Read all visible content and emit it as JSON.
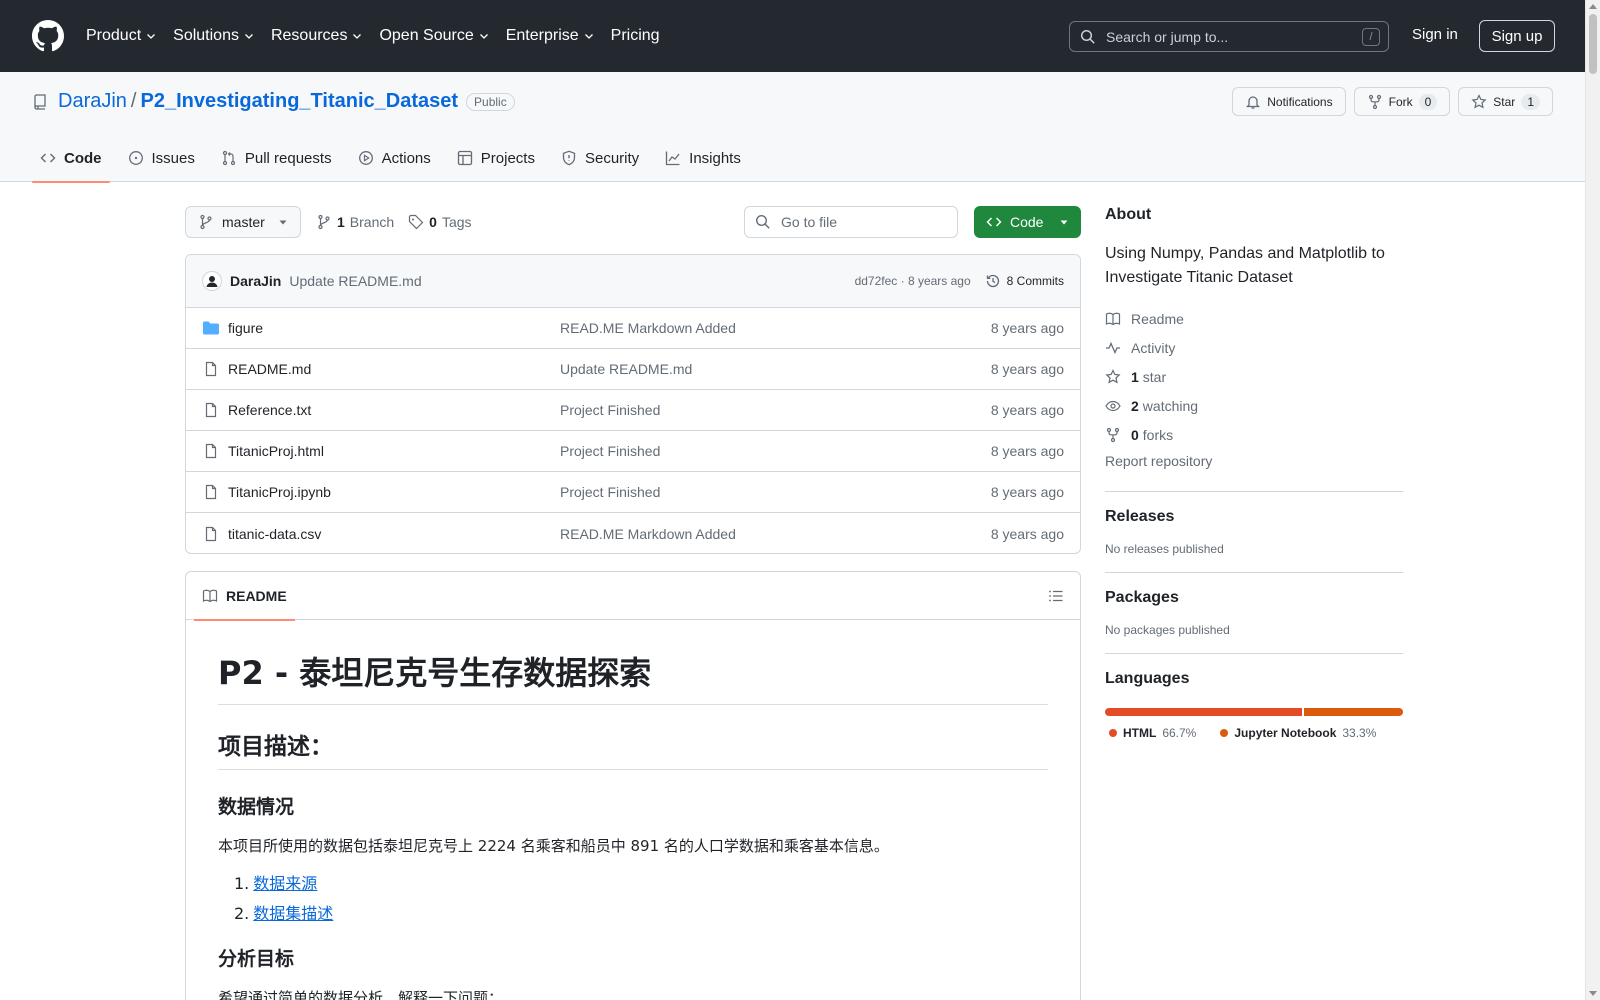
{
  "header": {
    "nav": [
      "Product",
      "Solutions",
      "Resources",
      "Open Source",
      "Enterprise",
      "Pricing"
    ],
    "search_placeholder": "Search or jump to...",
    "search_shortcut": "/",
    "signin": "Sign in",
    "signup": "Sign up"
  },
  "repo": {
    "owner": "DaraJin",
    "separator": "/",
    "name": "P2_Investigating_Titanic_Dataset",
    "visibility": "Public",
    "notifications_label": "Notifications",
    "fork_label": "Fork",
    "fork_count": "0",
    "star_label": "Star",
    "star_count": "1"
  },
  "tabs": [
    {
      "label": "Code",
      "icon": "code-icon",
      "active": true
    },
    {
      "label": "Issues",
      "icon": "issue-icon"
    },
    {
      "label": "Pull requests",
      "icon": "pull-request-icon"
    },
    {
      "label": "Actions",
      "icon": "play-icon"
    },
    {
      "label": "Projects",
      "icon": "table-icon"
    },
    {
      "label": "Security",
      "icon": "shield-icon"
    },
    {
      "label": "Insights",
      "icon": "graph-icon"
    }
  ],
  "toolbar": {
    "branch": "master",
    "branch_count": "1",
    "branch_label": "Branch",
    "tag_count": "0",
    "tag_label": "Tags",
    "goto_placeholder": "Go to file",
    "code_label": "Code"
  },
  "commit": {
    "author": "DaraJin",
    "message": "Update README.md",
    "sha_time": "dd72fec · 8 years ago",
    "commits_label": "8 Commits"
  },
  "files": [
    {
      "name": "figure",
      "type": "folder",
      "commit": "READ.ME Markdown Added",
      "age": "8 years ago"
    },
    {
      "name": "README.md",
      "type": "file",
      "commit": "Update README.md",
      "age": "8 years ago"
    },
    {
      "name": "Reference.txt",
      "type": "file",
      "commit": "Project Finished",
      "age": "8 years ago"
    },
    {
      "name": "TitanicProj.html",
      "type": "file",
      "commit": "Project Finished",
      "age": "8 years ago"
    },
    {
      "name": "TitanicProj.ipynb",
      "type": "file",
      "commit": "Project Finished",
      "age": "8 years ago"
    },
    {
      "name": "titanic-data.csv",
      "type": "file",
      "commit": "READ.ME Markdown Added",
      "age": "8 years ago"
    }
  ],
  "readme": {
    "tab_label": "README",
    "h1": "P2 - 泰坦尼克号生存数据探索",
    "h2": "项目描述：",
    "h3_data": "数据情况",
    "p_data": "本项目所使用的数据包括泰坦尼克号上 2224 名乘客和船员中 891 名的人口学数据和乘客基本信息。",
    "list": [
      {
        "n": "1.",
        "text": "数据来源"
      },
      {
        "n": "2.",
        "text": "数据集描述"
      }
    ],
    "h3_goal": "分析目标",
    "p_goal": "希望通过简单的数据分析，解释一下问题："
  },
  "about": {
    "title": "About",
    "description": "Using Numpy, Pandas and Matplotlib to Investigate Titanic Dataset",
    "readme": "Readme",
    "activity": "Activity",
    "stars_count": "1",
    "stars_label": "star",
    "watching_count": "2",
    "watching_label": "watching",
    "forks_count": "0",
    "forks_label": "forks",
    "report": "Report repository"
  },
  "releases": {
    "title": "Releases",
    "empty": "No releases published"
  },
  "packages": {
    "title": "Packages",
    "empty": "No packages published"
  },
  "languages": {
    "title": "Languages",
    "items": [
      {
        "name": "HTML",
        "percent": "66.7%",
        "value": 66.7,
        "color": "#e34c26"
      },
      {
        "name": "Jupyter Notebook",
        "percent": "33.3%",
        "value": 33.3,
        "color": "#DA5B0B"
      }
    ]
  },
  "colors": {
    "accent": "#0969da",
    "green": "#1f883d",
    "tab_underline": "#fd8c73",
    "header_bg": "#24292f"
  }
}
